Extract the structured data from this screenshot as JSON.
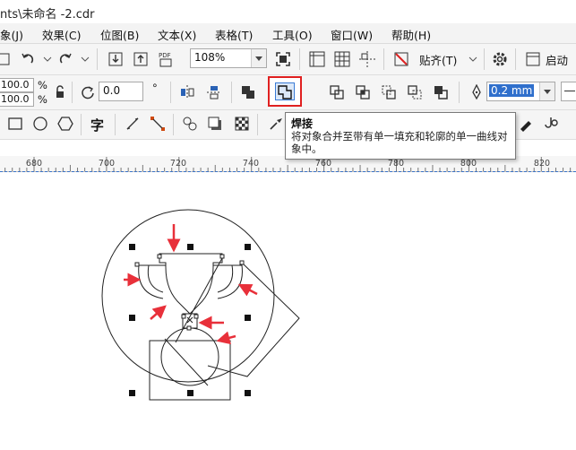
{
  "window": {
    "title": "nts\\未命名 -2.cdr"
  },
  "menu": {
    "items": [
      "象(J)",
      "效果(C)",
      "位图(B)",
      "文本(X)",
      "表格(T)",
      "工具(O)",
      "窗口(W)",
      "帮助(H)"
    ]
  },
  "standard_toolbar": {
    "zoom_value": "108%",
    "snap_label": "贴齐(T)",
    "launch_label": "启动"
  },
  "property_bar": {
    "scale_x": "100.0",
    "scale_y": "100.0",
    "percent_unit": "%",
    "rotation": "0.0",
    "degree_symbol": "°",
    "outline_width": "0.2 mm"
  },
  "tooltip": {
    "title": "焊接",
    "body": "将对象合并至带有单一填充和轮廓的单一曲线对象中。"
  },
  "ruler": {
    "labels": [
      "680",
      "700",
      "720",
      "740",
      "760",
      "780",
      "800",
      "820"
    ]
  },
  "toolbox": {
    "text_tool_glyph": "字"
  },
  "colors": {
    "highlight_border": "#e02020",
    "selection_blue": "#3a7bd5",
    "annotation_arrow": "#e8303a"
  }
}
